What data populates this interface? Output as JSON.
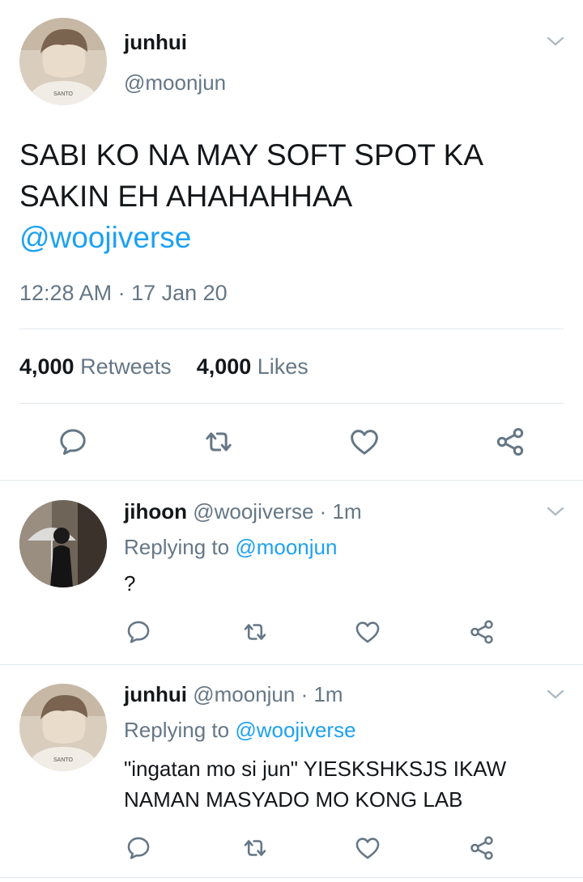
{
  "main_tweet": {
    "name": "junhui",
    "handle": "@moonjun",
    "text_line1": "SABI KO NA MAY SOFT SPOT KA",
    "text_line2": "SAKIN EH AHAHAHHAA",
    "mention": "@woojiverse",
    "timestamp": "12:28 AM · 17 Jan 20",
    "retweet_count": "4,000",
    "retweet_label": "Retweets",
    "like_count": "4,000",
    "like_label": "Likes",
    "avatar_shirt_text": "SANTO"
  },
  "replies": [
    {
      "name": "jihoon",
      "handle_time": "@woojiverse · 1m",
      "replying_label": "Replying to",
      "replying_to": "@moonjun",
      "text": "?"
    },
    {
      "name": "junhui",
      "handle_time": "@moonjun · 1m",
      "replying_label": "Replying to",
      "replying_to": "@woojiverse",
      "text_line1": "\"ingatan mo si jun\" YIESKSHKSJS IKAW",
      "text_line2": "NAMAN MASYADO MO KONG LAB",
      "avatar_shirt_text": "SANTO"
    }
  ],
  "icons": {
    "reply": "reply-icon",
    "retweet": "retweet-icon",
    "like": "heart-icon",
    "share": "share-icon",
    "menu": "chevron-down-icon"
  },
  "colors": {
    "link": "#1da1f2",
    "muted": "#657786",
    "divider": "#e1e8ed"
  }
}
